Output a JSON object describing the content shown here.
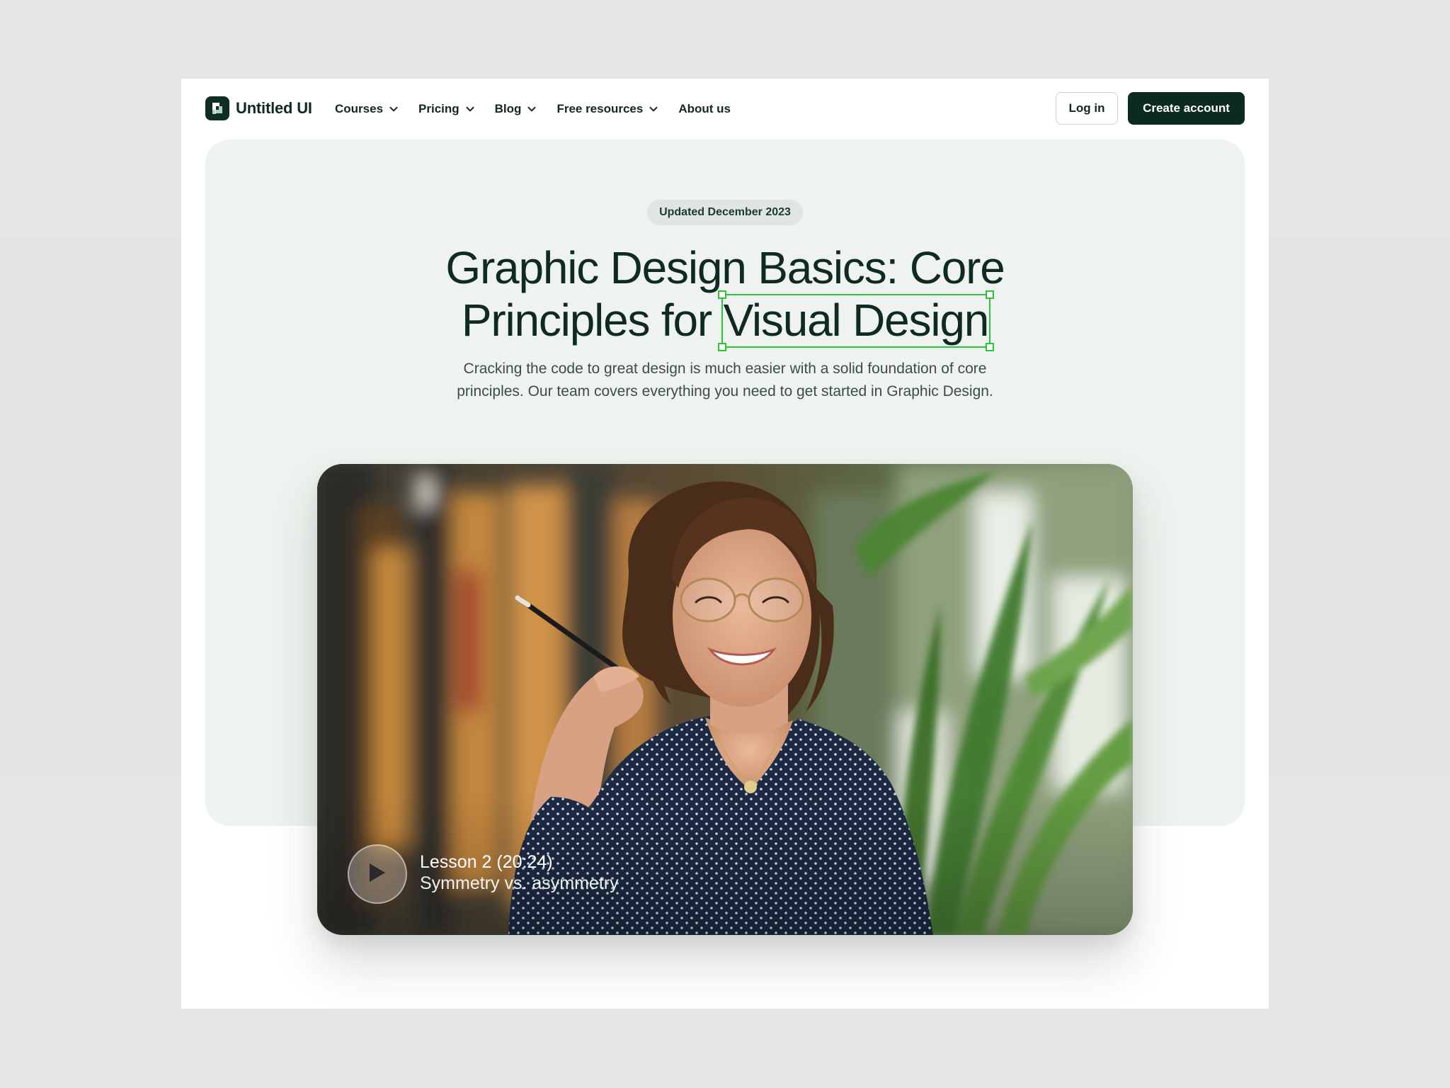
{
  "brand": {
    "name": "Untitled UI",
    "icon": "logo-mark-icon"
  },
  "nav": {
    "items": [
      {
        "label": "Courses",
        "has_dropdown": true
      },
      {
        "label": "Pricing",
        "has_dropdown": true
      },
      {
        "label": "Blog",
        "has_dropdown": true
      },
      {
        "label": "Free resources",
        "has_dropdown": true
      },
      {
        "label": "About us",
        "has_dropdown": false
      }
    ],
    "login_label": "Log in",
    "create_label": "Create account"
  },
  "hero": {
    "badge": "Updated December 2023",
    "headline_line1": "Graphic Design Basics: Core",
    "headline_line2_prefix": "Principles for",
    "headline_line2_highlight": "Visual Design",
    "subtitle_line1": "Cracking the code to great design is much easier with a solid foundation of core",
    "subtitle_line2": "principles. Our team covers everything you need to get started in Graphic Design."
  },
  "video": {
    "lesson_title": "Lesson 2 (20:24)",
    "lesson_subtitle": "Symmetry vs. asymmetry",
    "play_icon": "play-icon"
  },
  "colors": {
    "primary_dark": "#0b2a22",
    "hero_bg": "#eff3ef",
    "selection_green": "#2fc33c",
    "page_bg": "#e5e5e5"
  }
}
